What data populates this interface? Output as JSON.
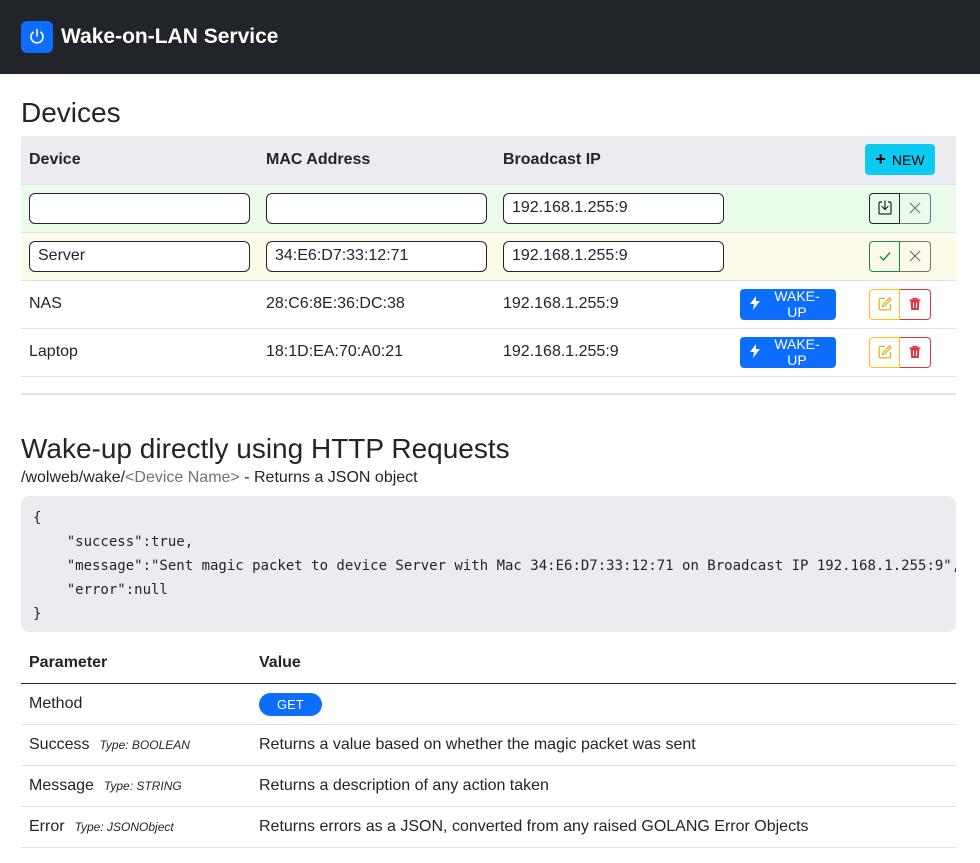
{
  "navbar": {
    "title": "Wake-on-LAN Service",
    "icon": "power-icon"
  },
  "devices_section": {
    "title": "Devices",
    "columns": {
      "device": "Device",
      "mac": "MAC Address",
      "broadcast": "Broadcast IP"
    },
    "new_button": "NEW",
    "new_row": {
      "device": "",
      "mac": "",
      "broadcast": "192.168.1.255:9"
    },
    "edit_row": {
      "device": "Server",
      "mac": "34:E6:D7:33:12:71",
      "broadcast": "192.168.1.255:9"
    },
    "rows": [
      {
        "device": "NAS",
        "mac": "28:C6:8E:36:DC:38",
        "broadcast": "192.168.1.255:9",
        "action": "WAKE-UP"
      },
      {
        "device": "Laptop",
        "mac": "18:1D:EA:70:A0:21",
        "broadcast": "192.168.1.255:9",
        "action": "WAKE-UP"
      }
    ]
  },
  "http_section": {
    "title": "Wake-up directly using HTTP Requests",
    "endpoint_path": "/wolweb/wake/",
    "endpoint_placeholder": "<Device Name>",
    "endpoint_desc": " - Returns a JSON object",
    "code": "{\n    \"success\":true,\n    \"message\":\"Sent magic packet to device Server with Mac 34:E6:D7:33:12:71 on Broadcast IP 192.168.1.255:9\",\n    \"error\":null\n}",
    "params_header": {
      "param": "Parameter",
      "value": "Value"
    },
    "params": [
      {
        "name": "Method",
        "type": "",
        "value": "GET"
      },
      {
        "name": "Success",
        "type": "Type: BOOLEAN",
        "value": "Returns a value based on whether the magic packet was sent"
      },
      {
        "name": "Message",
        "type": "Type: STRING",
        "value": "Returns a description of any action taken"
      },
      {
        "name": "Error",
        "type": "Type: JSONObject",
        "value": "Returns errors as a JSON, converted from any raised GOLANG Error Objects"
      }
    ]
  },
  "colors": {
    "navbar": "#212529",
    "primary": "#0d6efd",
    "info": "#0dcaf0",
    "success": "#198754",
    "warning": "#ffc107",
    "danger": "#dc3545"
  }
}
